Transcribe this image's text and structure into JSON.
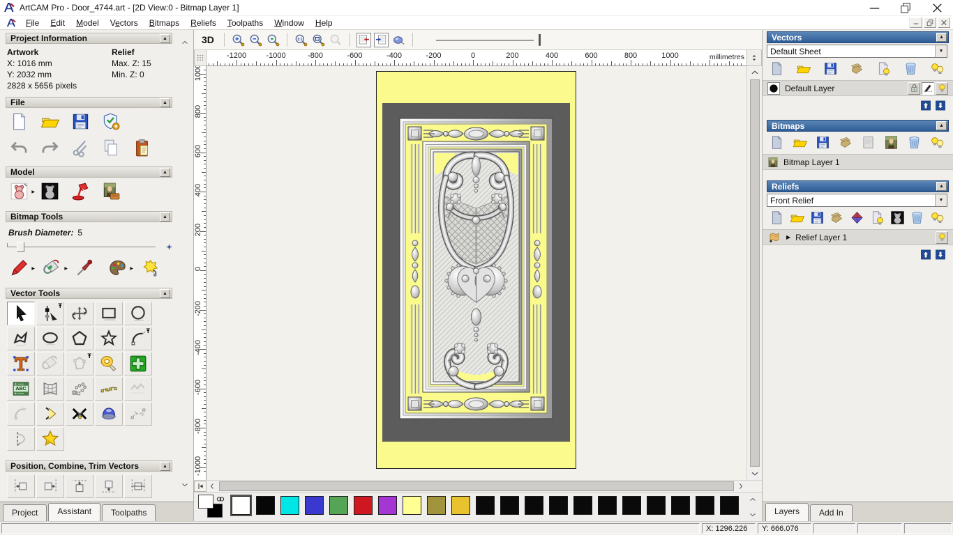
{
  "window": {
    "title": "ArtCAM Pro - Door_4744.art - [2D View:0 - Bitmap Layer 1]",
    "controls": [
      {
        "i": "win-minimize"
      },
      {
        "i": "win-restore"
      },
      {
        "i": "win-close"
      }
    ],
    "mdi_controls": [
      {
        "i": "mdi-minimize"
      },
      {
        "i": "mdi-restore"
      },
      {
        "i": "mdi-close"
      }
    ]
  },
  "menu": {
    "items": [
      {
        "label": "File",
        "m": 0
      },
      {
        "label": "Edit",
        "m": 0
      },
      {
        "label": "Model",
        "m": 0
      },
      {
        "label": "Vectors",
        "m": 1
      },
      {
        "label": "Bitmaps",
        "m": 0
      },
      {
        "label": "Reliefs",
        "m": 0
      },
      {
        "label": "Toolpaths",
        "m": 0
      },
      {
        "label": "Window",
        "m": 0
      },
      {
        "label": "Help",
        "m": 0
      }
    ]
  },
  "assistant": {
    "scroll_up": [
      {
        "i": "chevron-up"
      }
    ],
    "scroll_down": [
      {
        "i": "chevron-down"
      }
    ],
    "project_information": {
      "title": "Project Information",
      "artwork_heading": "Artwork",
      "relief_heading": "Relief",
      "artwork_x": "X: 1016 mm",
      "artwork_y": "Y: 2032 mm",
      "artwork_pixels": "2828 x 5656 pixels",
      "relief_max": "Max. Z: 15",
      "relief_min": "Min. Z: 0"
    },
    "file": {
      "title": "File",
      "row1": [
        {
          "i": "new-model"
        },
        {
          "i": "open-file"
        },
        {
          "i": "save-file"
        },
        {
          "i": "model-properties"
        }
      ],
      "row2": [
        {
          "i": "undo"
        },
        {
          "i": "redo"
        },
        {
          "i": "cut"
        },
        {
          "i": "copy"
        },
        {
          "i": "paste"
        }
      ]
    },
    "model": {
      "title": "Model",
      "row": [
        {
          "i": "sketch-relief",
          "arrow": true
        },
        {
          "i": "invert-relief"
        },
        {
          "i": "relief-lighting"
        },
        {
          "i": "import-image"
        }
      ]
    },
    "bitmap_tools": {
      "title": "Bitmap Tools",
      "brush_label": "Brush Diameter:",
      "brush_value": "5",
      "row": [
        {
          "i": "paint-brush",
          "arrow": true
        },
        {
          "i": "paint-bucket",
          "arrow": true
        },
        {
          "i": "colour-picker"
        },
        {
          "i": "colour-palette",
          "arrow": true
        },
        {
          "i": "flood-fill"
        }
      ]
    },
    "vector_tools": {
      "title": "Vector Tools",
      "grid": [
        {
          "i": "select-vectors",
          "pressed": true
        },
        {
          "i": "node-editing",
          "pin": true
        },
        {
          "i": "transform-vectors"
        },
        {
          "i": "create-rectangle"
        },
        {
          "i": "create-circle"
        },
        {
          "i": "create-polyline"
        },
        {
          "i": "create-ellipse"
        },
        {
          "i": "create-polygon"
        },
        {
          "i": "create-star"
        },
        {
          "i": "create-arc",
          "pin": true
        },
        {
          "i": "create-text"
        },
        {
          "i": "pour-gray"
        },
        {
          "i": "envelope-gray",
          "pin": true
        },
        {
          "i": "measure-tool"
        },
        {
          "i": "block-cross"
        },
        {
          "i": "text-block"
        },
        {
          "i": "envelope-distort"
        },
        {
          "i": "block-copy"
        },
        {
          "i": "fit-points"
        },
        {
          "i": "fit-wave"
        },
        {
          "i": "fit-arc"
        },
        {
          "i": "join-chevron"
        },
        {
          "i": "trim-vectors"
        },
        {
          "i": "extrude-3d"
        },
        {
          "i": "fit-handles"
        },
        {
          "i": "mirror-vectors"
        },
        {
          "i": "vector-doctor"
        }
      ]
    },
    "position": {
      "title": "Position, Combine, Trim Vectors",
      "row1": [
        {
          "i": "align-left"
        },
        {
          "i": "align-right"
        },
        {
          "i": "align-top"
        },
        {
          "i": "align-bottom"
        },
        {
          "i": "align-center"
        }
      ],
      "row2": [
        {
          "i": "center-page"
        },
        {
          "i": "center-page-2"
        },
        {
          "i": "align-top",
          "pin": true
        },
        {
          "i": "scatter-paste"
        },
        {
          "i": "nesting"
        }
      ]
    },
    "tabs": [
      "Project",
      "Assistant",
      "Toolpaths"
    ],
    "active_tab": "Assistant"
  },
  "canvas": {
    "toolbar": [
      {
        "label": "3D",
        "name": "view-3d"
      },
      {
        "sep": true
      },
      {
        "i": "zoom-in"
      },
      {
        "i": "zoom-out"
      },
      {
        "i": "zoom-previous"
      },
      {
        "sep": true
      },
      {
        "i": "zoom-1to1"
      },
      {
        "i": "zoom-object"
      },
      {
        "i": "zoom-drawing",
        "disabled": true
      },
      {
        "sep": true
      },
      {
        "i": "toggle-bitmap",
        "pressed": true
      },
      {
        "i": "toggle-vector",
        "pressed": true
      },
      {
        "i": "preview-relief"
      },
      {
        "sep": true
      },
      {
        "slider": true
      }
    ],
    "corner": [
      {
        "i": "corner-dots"
      }
    ],
    "units_spin": [
      {
        "i": "spin-updown"
      }
    ],
    "ruler": {
      "units": "millimetres",
      "h_labels": [
        "-1200",
        "-1000",
        "-800",
        "-600",
        "-400",
        "-200",
        "0",
        "200",
        "400",
        "600",
        "800",
        "1000"
      ],
      "v_labels": [
        "1000",
        "800",
        "600",
        "400",
        "200",
        "0",
        "-200",
        "-400",
        "-600",
        "-800",
        "-1000"
      ]
    },
    "vscroll": [
      {
        "i": "chevron-up"
      }
    ],
    "vscroll_end": [
      {
        "i": "chevron-down"
      }
    ],
    "hscroll_tool": [
      {
        "i": "hscroll-tool"
      }
    ],
    "hscroll_left": [
      {
        "i": "chevron-left"
      }
    ],
    "hscroll_right": [
      {
        "i": "chevron-right"
      }
    ]
  },
  "palette": {
    "primary": "#ffffff",
    "secondary": "#000000",
    "swatches": [
      "#ffffff",
      "#070707",
      "#00e6e6",
      "#3939cf",
      "#56a556",
      "#cf1722",
      "#a636d4",
      "#ffff94",
      "#a2943c",
      "#e8c22f",
      "#0a0a0a",
      "#0a0a0a",
      "#0a0a0a",
      "#0a0a0a",
      "#0a0a0a",
      "#0a0a0a",
      "#0a0a0a",
      "#0a0a0a",
      "#0a0a0a",
      "#0a0a0a",
      "#0a0a0a"
    ],
    "scroll": [
      {
        "i": "chevron-up"
      },
      {
        "i": "chevron-down"
      }
    ]
  },
  "right_panel": {
    "vectors": {
      "title": "Vectors",
      "sheet_value": "Default Sheet",
      "icons": [
        {
          "i": "sheet-new"
        },
        {
          "i": "open-file"
        },
        {
          "i": "save-file"
        },
        {
          "i": "stack-import"
        },
        {
          "i": "doc-bulb"
        },
        {
          "i": "trash"
        },
        {
          "i": "bulbs"
        }
      ],
      "layer_name": "Default Layer",
      "layer_controls": [
        {
          "i": "lock"
        },
        {
          "i": "pencil-snap",
          "pressed": true
        },
        {
          "i": "bulb"
        }
      ],
      "arrows": [
        {
          "i": "arrow-up"
        },
        {
          "i": "arrow-down"
        }
      ]
    },
    "bitmaps": {
      "title": "Bitmaps",
      "icons": [
        {
          "i": "sheet-new"
        },
        {
          "i": "open-file"
        },
        {
          "i": "save-file"
        },
        {
          "i": "stack-import"
        },
        {
          "i": "blank-doc"
        },
        {
          "i": "image-doc"
        },
        {
          "i": "trash"
        },
        {
          "i": "bulbs"
        }
      ],
      "layer_name": "Bitmap Layer 1"
    },
    "reliefs": {
      "title": "Reliefs",
      "relief_value": "Front Relief",
      "icons": [
        {
          "i": "sheet-new"
        },
        {
          "i": "open-file"
        },
        {
          "i": "save-file"
        },
        {
          "i": "stack-import"
        },
        {
          "i": "relief-combine"
        },
        {
          "i": "doc-bulb"
        },
        {
          "i": "greyscale-doc"
        },
        {
          "i": "trash"
        },
        {
          "i": "bulbs"
        }
      ],
      "layer_name": "Relief Layer 1",
      "layer_controls": [
        {
          "i": "bulb"
        }
      ],
      "arrows": [
        {
          "i": "arrow-up"
        },
        {
          "i": "arrow-down"
        }
      ]
    },
    "tabs": [
      "Layers",
      "Add In"
    ],
    "active_tab": "Layers"
  },
  "status_bar": {
    "x": "X: 1296.226",
    "y": "Y: 666.076"
  }
}
